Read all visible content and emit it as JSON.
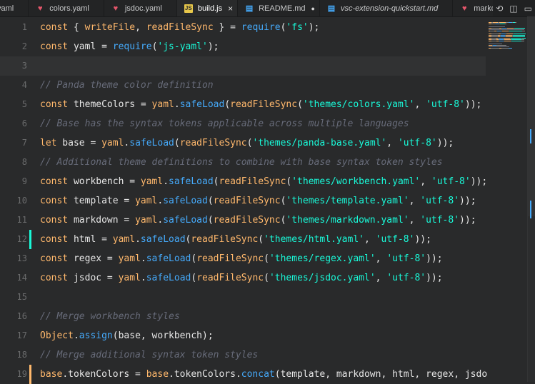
{
  "tabs": [
    {
      "label": "yaml",
      "icon": "yaml-file-icon",
      "active": false,
      "italic": false,
      "close": "",
      "dot": false
    },
    {
      "label": "colors.yaml",
      "icon": "yaml-file-icon",
      "active": false,
      "italic": false,
      "close": "",
      "dot": false
    },
    {
      "label": "jsdoc.yaml",
      "icon": "yaml-file-icon",
      "active": false,
      "italic": false,
      "close": "",
      "dot": false
    },
    {
      "label": "build.js",
      "icon": "js-file-icon",
      "active": true,
      "italic": false,
      "close": "×",
      "dot": false
    },
    {
      "label": "README.md",
      "icon": "markdown-file-icon",
      "active": false,
      "italic": false,
      "close": "",
      "dot": true
    },
    {
      "label": "vsc-extension-quickstart.md",
      "icon": "markdown-file-icon",
      "active": false,
      "italic": true,
      "close": "",
      "dot": false
    },
    {
      "label": "markdown.yaml",
      "icon": "yaml-file-icon",
      "active": false,
      "italic": false,
      "close": "",
      "dot": false
    }
  ],
  "editor_actions": [
    {
      "name": "open-changes-icon",
      "glyph": "⟲"
    },
    {
      "name": "split-editor-icon",
      "glyph": "◫"
    },
    {
      "name": "toggle-panel-icon",
      "glyph": "▭"
    }
  ],
  "colors": {
    "keyword": "#ffb86c",
    "string": "#19f9d8",
    "method": "#45a9f9",
    "comment": "#676b79",
    "text": "#e6e6e6",
    "background": "#292a2b"
  },
  "lines": [
    {
      "n": "1",
      "tokens": [
        [
          "k",
          "const"
        ],
        [
          "p",
          " { "
        ],
        [
          "k",
          "writeFile"
        ],
        [
          "p",
          ", "
        ],
        [
          "k",
          "readFileSync"
        ],
        [
          "p",
          " } = "
        ],
        [
          "m",
          "require"
        ],
        [
          "p",
          "("
        ],
        [
          "s",
          "'fs'"
        ],
        [
          "p",
          ");"
        ]
      ]
    },
    {
      "n": "2",
      "tokens": [
        [
          "k",
          "const"
        ],
        [
          "p",
          " yaml = "
        ],
        [
          "m",
          "require"
        ],
        [
          "p",
          "("
        ],
        [
          "s",
          "'js-yaml'"
        ],
        [
          "p",
          ");"
        ]
      ]
    },
    {
      "n": "3",
      "tokens": [],
      "current": true
    },
    {
      "n": "4",
      "tokens": [
        [
          "c",
          "// Panda theme color definition"
        ]
      ]
    },
    {
      "n": "5",
      "tokens": [
        [
          "k",
          "const"
        ],
        [
          "p",
          " themeColors = "
        ],
        [
          "k",
          "yaml"
        ],
        [
          "p",
          "."
        ],
        [
          "m",
          "safeLoad"
        ],
        [
          "p",
          "("
        ],
        [
          "k",
          "readFileSync"
        ],
        [
          "p",
          "("
        ],
        [
          "s",
          "'themes/colors.yaml'"
        ],
        [
          "p",
          ", "
        ],
        [
          "s",
          "'utf-8'"
        ],
        [
          "p",
          "));"
        ]
      ]
    },
    {
      "n": "6",
      "tokens": [
        [
          "c",
          "// Base has the syntax tokens applicable across multiple languages"
        ]
      ]
    },
    {
      "n": "7",
      "tokens": [
        [
          "k",
          "let"
        ],
        [
          "p",
          " base = "
        ],
        [
          "k",
          "yaml"
        ],
        [
          "p",
          "."
        ],
        [
          "m",
          "safeLoad"
        ],
        [
          "p",
          "("
        ],
        [
          "k",
          "readFileSync"
        ],
        [
          "p",
          "("
        ],
        [
          "s",
          "'themes/panda-base.yaml'"
        ],
        [
          "p",
          ", "
        ],
        [
          "s",
          "'utf-8'"
        ],
        [
          "p",
          "));"
        ]
      ]
    },
    {
      "n": "8",
      "tokens": [
        [
          "c",
          "// Additional theme definitions to combine with base syntax token styles"
        ]
      ]
    },
    {
      "n": "9",
      "tokens": [
        [
          "k",
          "const"
        ],
        [
          "p",
          " workbench = "
        ],
        [
          "k",
          "yaml"
        ],
        [
          "p",
          "."
        ],
        [
          "m",
          "safeLoad"
        ],
        [
          "p",
          "("
        ],
        [
          "k",
          "readFileSync"
        ],
        [
          "p",
          "("
        ],
        [
          "s",
          "'themes/workbench.yaml'"
        ],
        [
          "p",
          ", "
        ],
        [
          "s",
          "'utf-8'"
        ],
        [
          "p",
          "));"
        ]
      ]
    },
    {
      "n": "10",
      "tokens": [
        [
          "k",
          "const"
        ],
        [
          "p",
          " template = "
        ],
        [
          "k",
          "yaml"
        ],
        [
          "p",
          "."
        ],
        [
          "m",
          "safeLoad"
        ],
        [
          "p",
          "("
        ],
        [
          "k",
          "readFileSync"
        ],
        [
          "p",
          "("
        ],
        [
          "s",
          "'themes/template.yaml'"
        ],
        [
          "p",
          ", "
        ],
        [
          "s",
          "'utf-8'"
        ],
        [
          "p",
          "));"
        ]
      ]
    },
    {
      "n": "11",
      "tokens": [
        [
          "k",
          "const"
        ],
        [
          "p",
          " markdown = "
        ],
        [
          "k",
          "yaml"
        ],
        [
          "p",
          "."
        ],
        [
          "m",
          "safeLoad"
        ],
        [
          "p",
          "("
        ],
        [
          "k",
          "readFileSync"
        ],
        [
          "p",
          "("
        ],
        [
          "s",
          "'themes/markdown.yaml'"
        ],
        [
          "p",
          ", "
        ],
        [
          "s",
          "'utf-8'"
        ],
        [
          "p",
          "));"
        ]
      ]
    },
    {
      "n": "12",
      "tokens": [
        [
          "k",
          "const"
        ],
        [
          "p",
          " html = "
        ],
        [
          "k",
          "yaml"
        ],
        [
          "p",
          "."
        ],
        [
          "m",
          "safeLoad"
        ],
        [
          "p",
          "("
        ],
        [
          "k",
          "readFileSync"
        ],
        [
          "p",
          "("
        ],
        [
          "s",
          "'themes/html.yaml'"
        ],
        [
          "p",
          ", "
        ],
        [
          "s",
          "'utf-8'"
        ],
        [
          "p",
          "));"
        ]
      ],
      "gutter": "green"
    },
    {
      "n": "13",
      "tokens": [
        [
          "k",
          "const"
        ],
        [
          "p",
          " regex = "
        ],
        [
          "k",
          "yaml"
        ],
        [
          "p",
          "."
        ],
        [
          "m",
          "safeLoad"
        ],
        [
          "p",
          "("
        ],
        [
          "k",
          "readFileSync"
        ],
        [
          "p",
          "("
        ],
        [
          "s",
          "'themes/regex.yaml'"
        ],
        [
          "p",
          ", "
        ],
        [
          "s",
          "'utf-8'"
        ],
        [
          "p",
          "));"
        ]
      ]
    },
    {
      "n": "14",
      "tokens": [
        [
          "k",
          "const"
        ],
        [
          "p",
          " jsdoc = "
        ],
        [
          "k",
          "yaml"
        ],
        [
          "p",
          "."
        ],
        [
          "m",
          "safeLoad"
        ],
        [
          "p",
          "("
        ],
        [
          "k",
          "readFileSync"
        ],
        [
          "p",
          "("
        ],
        [
          "s",
          "'themes/jsdoc.yaml'"
        ],
        [
          "p",
          ", "
        ],
        [
          "s",
          "'utf-8'"
        ],
        [
          "p",
          "));"
        ]
      ]
    },
    {
      "n": "15",
      "tokens": []
    },
    {
      "n": "16",
      "tokens": [
        [
          "c",
          "// Merge workbench styles"
        ]
      ]
    },
    {
      "n": "17",
      "tokens": [
        [
          "k",
          "Object"
        ],
        [
          "p",
          "."
        ],
        [
          "m",
          "assign"
        ],
        [
          "p",
          "(base, workbench);"
        ]
      ]
    },
    {
      "n": "18",
      "tokens": [
        [
          "c",
          "// Merge additional syntax token styles"
        ]
      ]
    },
    {
      "n": "19",
      "tokens": [
        [
          "k",
          "base"
        ],
        [
          "p",
          "."
        ],
        [
          "p",
          "tokenColors = "
        ],
        [
          "k",
          "base"
        ],
        [
          "p",
          "."
        ],
        [
          "p",
          "tokenColors."
        ],
        [
          "m",
          "concat"
        ],
        [
          "p",
          "(template, markdown, html, regex, jsdo"
        ]
      ],
      "gutter": "orange"
    }
  ]
}
